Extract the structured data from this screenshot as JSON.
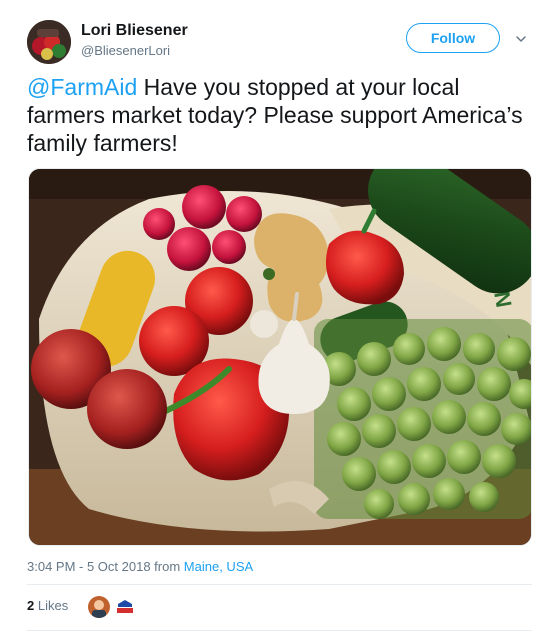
{
  "header": {
    "display_name": "Lori Bliesener",
    "handle": "@BliesenerLori",
    "follow_label": "Follow"
  },
  "tweet": {
    "mention": "@FarmAid",
    "text": " Have you stopped at your local farmers market today?  Please support America’s family farmers!",
    "image_alt": "Photo of farmers market produce"
  },
  "meta": {
    "time_prefix": "3:04 PM - 5 Oct 2018 from ",
    "location": "Maine, USA"
  },
  "engagement": {
    "likes_count": "2",
    "likes_label": " Likes"
  },
  "colors": {
    "accent": "#1da1f2",
    "muted": "#657786",
    "text": "#14171a"
  }
}
